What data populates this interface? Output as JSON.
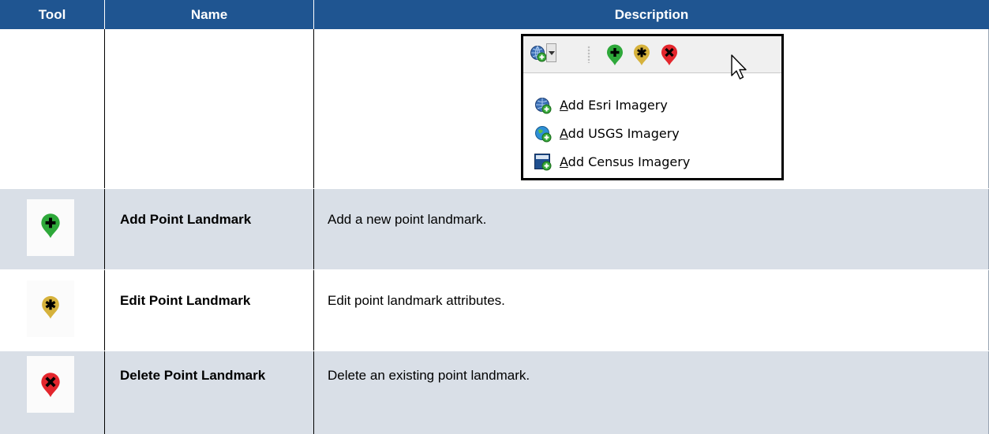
{
  "headers": {
    "tool": "Tool",
    "name": "Name",
    "description": "Description"
  },
  "popup": {
    "menu_items": [
      {
        "accel": "A",
        "rest": "dd Esri Imagery",
        "icon": "esri-globe-add-icon"
      },
      {
        "accel": "A",
        "rest": "dd USGS Imagery",
        "icon": "usgs-globe-add-icon"
      },
      {
        "accel": "A",
        "rest": "dd Census Imagery",
        "icon": "census-add-icon"
      }
    ]
  },
  "rows": [
    {
      "name": "Add Point Landmark",
      "description": "Add a new point landmark.",
      "icon": "add-point-landmark-icon"
    },
    {
      "name": "Edit Point Landmark",
      "description": "Edit point landmark attributes.",
      "icon": "edit-point-landmark-icon"
    },
    {
      "name": "Delete Point Landmark",
      "description": "Delete an existing point landmark.",
      "icon": "delete-point-landmark-icon"
    }
  ],
  "colors": {
    "header_bg": "#1f5591",
    "row_alt_bg": "#d9dfe7",
    "add_green": "#2ea83a",
    "edit_yellow": "#d6b23c",
    "delete_red": "#e3262d"
  }
}
